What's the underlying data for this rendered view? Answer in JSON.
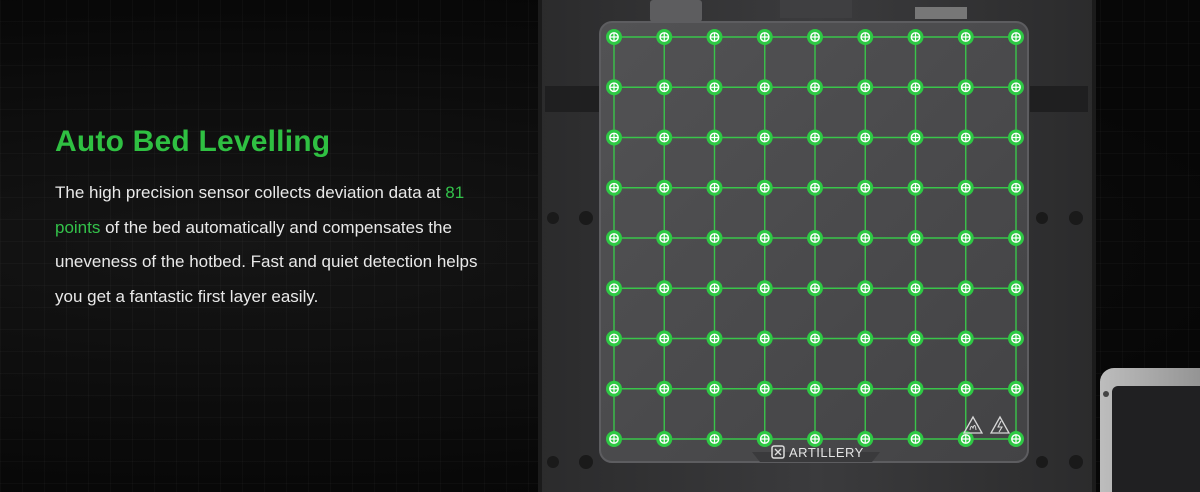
{
  "heading": "Auto Bed Levelling",
  "description": {
    "before": "The high precision sensor collects deviation data at ",
    "highlight": "81 points",
    "after": " of the bed automatically and compensates the uneveness of the hotbed. Fast and quiet detection helps you get a fantastic first layer easily."
  },
  "brand": "ARTILLERY",
  "grid": {
    "columns": 9,
    "rows": 9
  },
  "colors": {
    "accent": "#2fc042",
    "grid_line": "#39c54a",
    "bed": "#4a4a4c",
    "background": "#0a0a0a"
  },
  "icons": [
    "brand-logo-icon",
    "hot-surface-warning-icon",
    "electric-warning-icon"
  ]
}
